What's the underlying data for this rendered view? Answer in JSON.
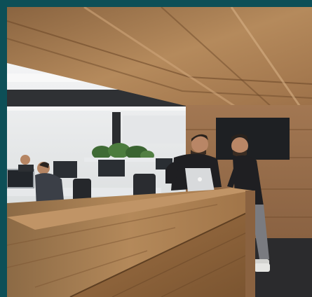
{
  "image": {
    "border_color": "#0d4f57",
    "scene": "office-with-wooden-reception-desk",
    "colors": {
      "wood_light": "#b98a57",
      "wood_mid": "#9a6b3e",
      "wood_dark": "#6e4a2a",
      "wall_white": "#e9ecee",
      "floor_dark": "#2b2b2d",
      "plant_green": "#3f6b35",
      "shirt_black": "#1f1f22",
      "jeans_grey": "#7a7b80",
      "laptop_silver": "#d8dadc"
    }
  }
}
